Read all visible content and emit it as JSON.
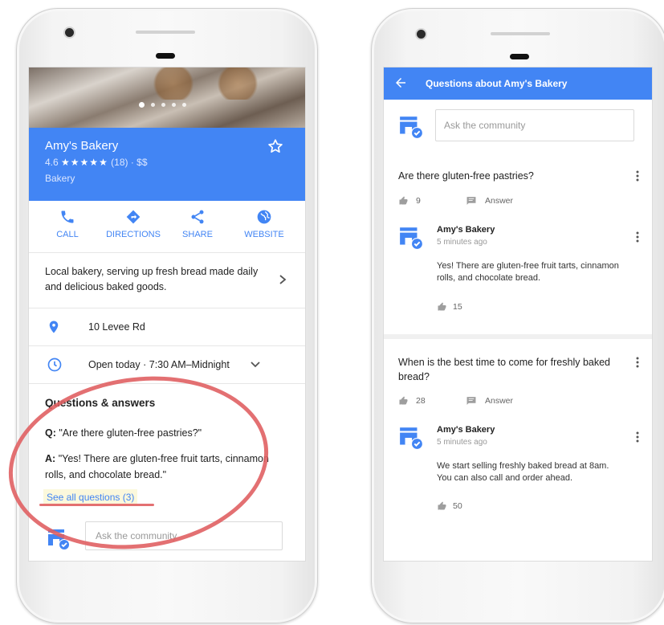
{
  "colors": {
    "brand_blue": "#4285f4",
    "annotation_red": "#e06063",
    "highlight": "#fbf8dc"
  },
  "left": {
    "business": {
      "name": "Amy's Bakery",
      "rating_value": "4.6",
      "stars": "★★★★★",
      "rating_rest": "(18) · $$",
      "category": "Bakery"
    },
    "actions": [
      {
        "label": "CALL",
        "icon": "phone-icon"
      },
      {
        "label": "DIRECTIONS",
        "icon": "directions-icon"
      },
      {
        "label": "SHARE",
        "icon": "share-icon"
      },
      {
        "label": "WEBSITE",
        "icon": "globe-icon"
      }
    ],
    "description": "Local bakery, serving up fresh bread made daily and delicious baked goods.",
    "address": "10 Levee Rd",
    "hours": "Open today · 7:30 AM–Midnight",
    "qa": {
      "title": "Questions & answers",
      "q_prefix": "Q:",
      "question": "\"Are there gluten-free pastries?\"",
      "a_prefix": "A:",
      "answer": "\"Yes! There are gluten-free fruit tarts, cinnamon rolls, and chocolate bread.\"",
      "see_all": "See all questions (3)",
      "ask_placeholder": "Ask the community"
    }
  },
  "right": {
    "title": "Questions about Amy's Bakery",
    "ask_placeholder": "Ask the community",
    "questions": [
      {
        "text": "Are there gluten-free pastries?",
        "votes": "9",
        "answer_label": "Answer",
        "reply": {
          "author": "Amy's Bakery",
          "time": "5 minutes ago",
          "text": "Yes! There are gluten-free fruit tarts, cinnamon rolls, and chocolate bread.",
          "likes": "15"
        }
      },
      {
        "text": "When is the best time to come for freshly baked bread?",
        "votes": "28",
        "answer_label": "Answer",
        "reply": {
          "author": "Amy's Bakery",
          "time": "5 minutes ago",
          "text": "We start selling freshly baked bread at 8am. You can also call and order ahead.",
          "likes": "50"
        }
      }
    ]
  }
}
